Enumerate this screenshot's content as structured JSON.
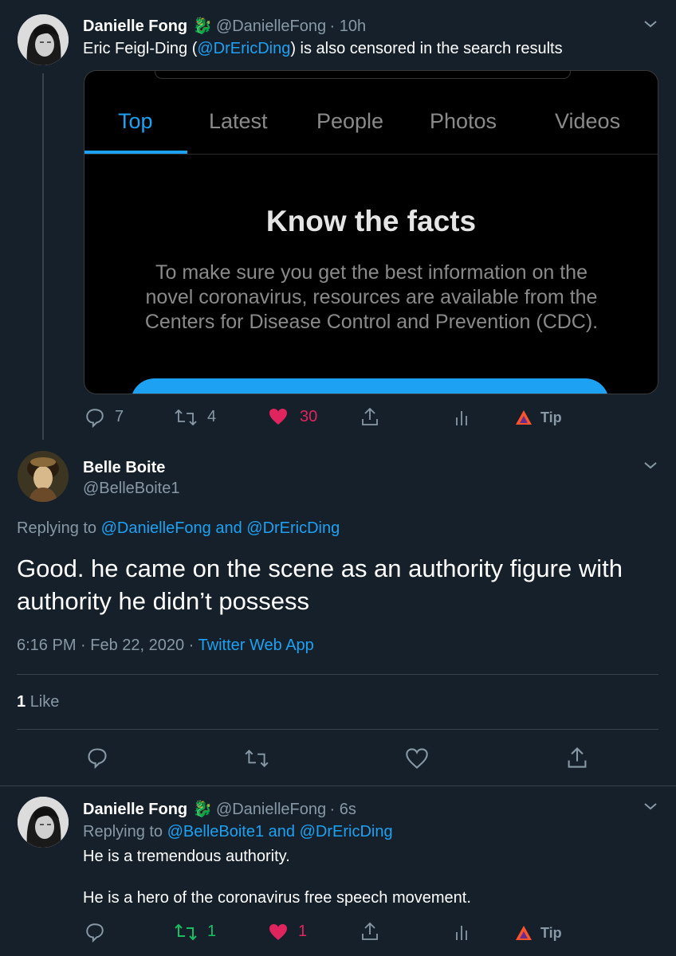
{
  "tweet1": {
    "name": "Danielle Fong",
    "handle": "@DanielleFong",
    "time": "10h",
    "text_pre": "Eric Feigl-Ding (",
    "text_mention": "@DrEricDing",
    "text_post": ") is also censored in the search results",
    "embed": {
      "tabs": [
        "Top",
        "Latest",
        "People",
        "Photos",
        "Videos"
      ],
      "active_tab": "Top",
      "heading": "Know the facts",
      "body": "To make sure you get the best information on the novel coronavirus, resources are available from the Centers for Disease Control and Prevention (CDC)."
    },
    "actions": {
      "replies": "7",
      "retweets": "4",
      "likes": "30",
      "tip": "Tip"
    }
  },
  "tweet2": {
    "name": "Belle Boite",
    "handle": "@BelleBoite1",
    "replying_label": "Replying to",
    "replying_to": "@DanielleFong and @DrEricDing",
    "text_line1": "Good.  he came on the scene as an authority figure with",
    "text_line2": "authority he didn’t possess",
    "timestamp": "6:16 PM · Feb 22, 2020 ·",
    "source": "Twitter Web App",
    "likes_count": "1",
    "likes_label": "Like"
  },
  "tweet3": {
    "name": "Danielle Fong",
    "handle": "@DanielleFong",
    "time": "6s",
    "replying_label": "Replying to",
    "replying_to": "@BelleBoite1 and @DrEricDing",
    "line1": "He is a tremendous authority.",
    "line2": "He is a hero of the coronavirus free speech movement.",
    "actions": {
      "retweets": "1",
      "likes": "1",
      "tip": "Tip"
    }
  },
  "colors": {
    "background": "#15202b",
    "accent_blue": "#1da1f2",
    "like_red": "#e0245e",
    "retweet_green": "#17bf63",
    "muted": "#8899a6"
  }
}
